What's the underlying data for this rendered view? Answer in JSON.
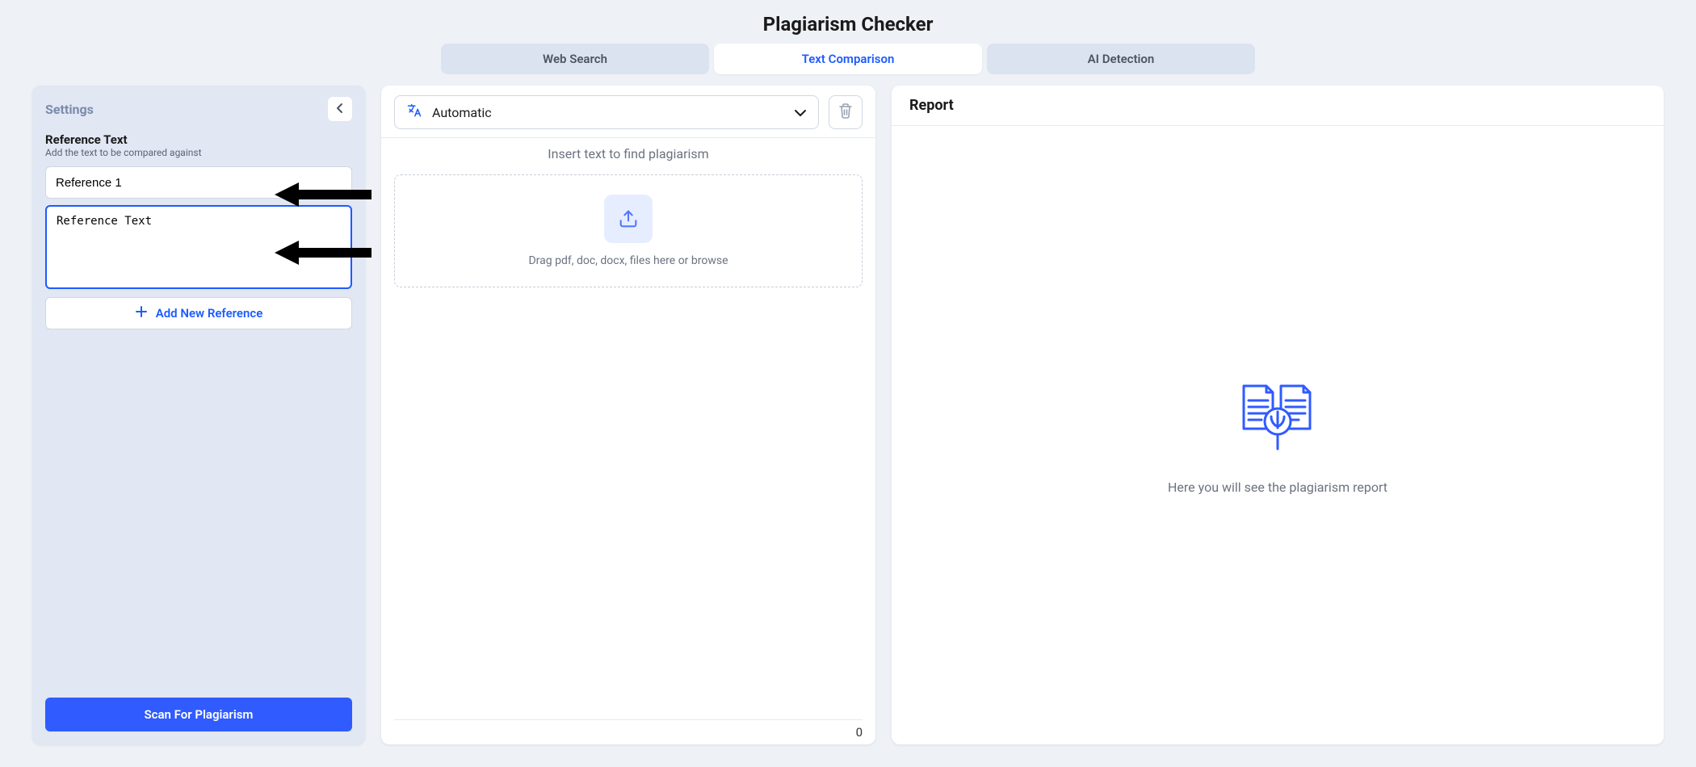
{
  "page_title": "Plagiarism Checker",
  "tabs": [
    {
      "label": "Web Search",
      "active": false
    },
    {
      "label": "Text Comparison",
      "active": true
    },
    {
      "label": "AI Detection",
      "active": false
    }
  ],
  "settings": {
    "title": "Settings",
    "reference": {
      "heading": "Reference Text",
      "subheading": "Add the text to be compared against",
      "name_value": "Reference 1",
      "text_placeholder": "Reference Text",
      "text_value": "Reference Text"
    },
    "add_reference_label": "Add New Reference",
    "scan_label": "Scan For Plagiarism"
  },
  "input": {
    "language_label": "Automatic",
    "insert_hint": "Insert text to find plagiarism",
    "dropzone_text": "Drag pdf, doc, docx, files here or browse",
    "char_count": "0"
  },
  "report": {
    "title": "Report",
    "empty_hint": "Here you will see the plagiarism report"
  }
}
